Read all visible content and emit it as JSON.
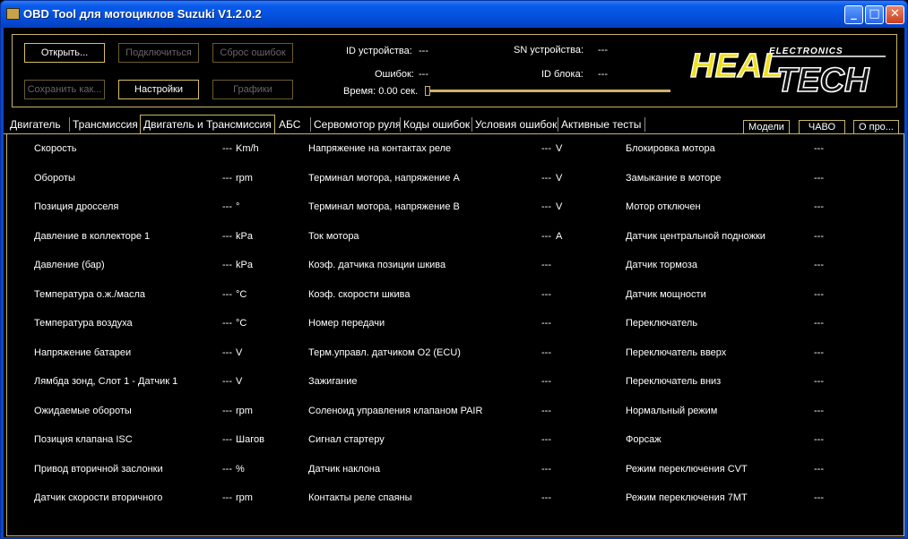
{
  "window": {
    "title": "OBD Tool для мотоциклов Suzuki V1.2.0.2",
    "minimize": "_",
    "maximize": "□",
    "close": "✕"
  },
  "toolbar": {
    "open": "Открыть...",
    "connect": "Подключиться",
    "reset_errors": "Сброс ошибок",
    "save_as": "Сохранить как...",
    "settings": "Настройки",
    "graphs": "Графики"
  },
  "device": {
    "id_label": "ID устройства:",
    "id_value": "---",
    "sn_label": "SN устройства:",
    "sn_value": "---",
    "errors_label": "Ошибок:",
    "errors_value": "---",
    "block_label": "ID блока:",
    "block_value": "---",
    "time_label": "Время: 0.00 сек."
  },
  "logo": {
    "line1": "HEAL",
    "line2": "TECH",
    "sub": "ELECTRONICS"
  },
  "tabs": [
    "Двигатель",
    "Трансмиссия",
    "Двигатель и Трансмиссия",
    "АБС",
    "Сервомотор руля",
    "Коды ошибок",
    "Условия ошибок",
    "Активные тесты"
  ],
  "active_tab": 2,
  "right_buttons": {
    "models": "Модели",
    "faq": "ЧАВО",
    "about": "О про..."
  },
  "col1": [
    {
      "label": "Скорость",
      "value": "---",
      "unit": "Km/h"
    },
    {
      "label": "Обороты",
      "value": "---",
      "unit": "rpm"
    },
    {
      "label": "Позиция дросселя",
      "value": "---",
      "unit": "°"
    },
    {
      "label": "Давление в коллекторе 1",
      "value": "---",
      "unit": "kPa"
    },
    {
      "label": "Давление (бар)",
      "value": "---",
      "unit": "kPa"
    },
    {
      "label": "Температура о.ж./масла",
      "value": "---",
      "unit": "°C"
    },
    {
      "label": "Температура воздуха",
      "value": "---",
      "unit": "°C"
    },
    {
      "label": "Напряжение батареи",
      "value": "---",
      "unit": "V"
    },
    {
      "label": "Лямбда зонд, Слот 1 - Датчик 1",
      "value": "---",
      "unit": "V"
    },
    {
      "label": "Ожидаемые обороты",
      "value": "---",
      "unit": "rpm"
    },
    {
      "label": "Позиция клапана ISC",
      "value": "---",
      "unit": "Шагов"
    },
    {
      "label": "Привод вторичной заслонки",
      "value": "---",
      "unit": "%"
    },
    {
      "label": "Датчик скорости вторичного",
      "value": "---",
      "unit": "rpm"
    }
  ],
  "col2": [
    {
      "label": "Напряжение на контактах реле",
      "value": "---",
      "unit": "V"
    },
    {
      "label": "Терминал мотора, напряжение A",
      "value": "---",
      "unit": "V"
    },
    {
      "label": "Терминал мотора, напряжение B",
      "value": "---",
      "unit": "V"
    },
    {
      "label": "Ток мотора",
      "value": "---",
      "unit": "A"
    },
    {
      "label": "Коэф. датчика позиции шкива",
      "value": "---",
      "unit": ""
    },
    {
      "label": "Коэф. скорости шкива",
      "value": "---",
      "unit": ""
    },
    {
      "label": "Номер передачи",
      "value": "---",
      "unit": ""
    },
    {
      "label": "Терм.управл. датчиком O2 (ECU)",
      "value": "---",
      "unit": ""
    },
    {
      "label": "Зажигание",
      "value": "---",
      "unit": ""
    },
    {
      "label": "Соленоид управления клапаном PAIR",
      "value": "---",
      "unit": ""
    },
    {
      "label": "Сигнал стартеру",
      "value": "---",
      "unit": ""
    },
    {
      "label": "Датчик наклона",
      "value": "---",
      "unit": ""
    },
    {
      "label": "Контакты реле спаяны",
      "value": "---",
      "unit": ""
    }
  ],
  "col3": [
    {
      "label": "Блокировка мотора",
      "value": "---"
    },
    {
      "label": "Замыкание в моторе",
      "value": "---"
    },
    {
      "label": "Мотор отключен",
      "value": "---"
    },
    {
      "label": "Датчик центральной подножки",
      "value": "---"
    },
    {
      "label": "Датчик тормоза",
      "value": "---"
    },
    {
      "label": "Датчик мощности",
      "value": "---"
    },
    {
      "label": "Переключатель",
      "value": "---"
    },
    {
      "label": "Переключатель вверх",
      "value": "---"
    },
    {
      "label": "Переключатель вниз",
      "value": "---"
    },
    {
      "label": "Нормальный режим",
      "value": "---"
    },
    {
      "label": "Форсаж",
      "value": "---"
    },
    {
      "label": "Режим переключения CVT",
      "value": "---"
    },
    {
      "label": "Режим переключения 7MT",
      "value": "---"
    }
  ],
  "colors": {
    "accent": "#c9b46a",
    "titlebar": "#0553e0",
    "background": "#000000",
    "text": "#ffffff"
  }
}
